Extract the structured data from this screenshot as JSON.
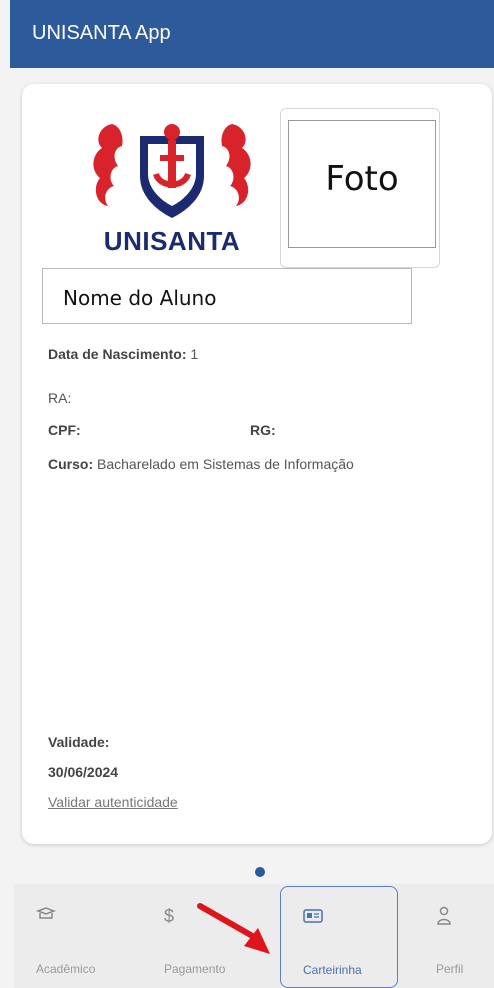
{
  "app": {
    "title": "UNISANTA App"
  },
  "card": {
    "logo_text": "UNISANTA",
    "photo_label": "Foto",
    "student_name": "Nome do Aluno",
    "fields": {
      "birth_label": "Data de Nascimento:",
      "birth_value": "1",
      "ra_label": "RA:",
      "cpf_label": "CPF:",
      "rg_label": "RG:",
      "course_label": "Curso:",
      "course_value": "Bacharelado em Sistemas de Informação"
    },
    "validity_label": "Validade:",
    "validity_date": "30/06/2024",
    "validate_link": "Validar autenticidade"
  },
  "nav": {
    "items": [
      {
        "label": "Acadêmico",
        "icon": "graduation-cap-icon"
      },
      {
        "label": "Pagamento",
        "icon": "dollar-icon"
      },
      {
        "label": "Carteirinha",
        "icon": "id-card-icon"
      },
      {
        "label": "Perfil",
        "icon": "person-icon"
      }
    ],
    "active_index": 2
  },
  "colors": {
    "primary": "#2d5a9a",
    "logo_red": "#d8232a",
    "logo_blue": "#1c2a72"
  }
}
